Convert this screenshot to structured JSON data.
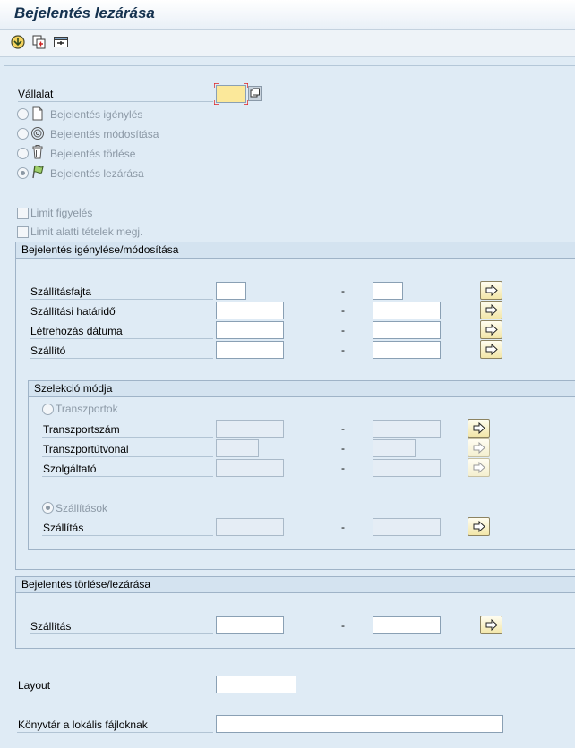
{
  "window": {
    "title": "Bejelentés lezárása"
  },
  "toolbar": {
    "buttons": [
      {
        "icon": "execute-icon"
      },
      {
        "icon": "copy-variant-icon"
      },
      {
        "icon": "selection-options-icon"
      }
    ]
  },
  "header": {
    "company_label": "Vállalat",
    "company_value": ""
  },
  "mode_options": [
    {
      "label": "Bejelentés igénylés",
      "icon": "document-icon",
      "selected": false
    },
    {
      "label": "Bejelentés módosítása",
      "icon": "spiral-icon",
      "selected": false
    },
    {
      "label": "Bejelentés törlése",
      "icon": "trash-icon",
      "selected": false
    },
    {
      "label": "Bejelentés lezárása",
      "icon": "flag-icon",
      "selected": true
    }
  ],
  "checkboxes": {
    "limit_watch": "Limit figyelés",
    "below_limit_items": "Limit alatti tételek megj."
  },
  "request_group": {
    "title": "Bejelentés igénylése/módosítása",
    "rows": [
      {
        "label": "Szállításfajta",
        "from": "",
        "to": ""
      },
      {
        "label": "Szállítási határidő",
        "from": "",
        "to": ""
      },
      {
        "label": "Létrehozás dátuma",
        "from": "",
        "to": ""
      },
      {
        "label": "Szállító",
        "from": "",
        "to": ""
      }
    ],
    "selection": {
      "title": "Szelekció módja",
      "transports_radio": "Transzportok",
      "transport_rows": [
        {
          "label": "Transzportszám",
          "from": "",
          "to": ""
        },
        {
          "label": "Transzportútvonal",
          "from": "",
          "to": ""
        },
        {
          "label": "Szolgáltató",
          "from": "",
          "to": ""
        }
      ],
      "deliveries_radio": "Szállítások",
      "delivery_row": {
        "label": "Szállítás",
        "from": "",
        "to": ""
      }
    }
  },
  "close_group": {
    "title": "Bejelentés törlése/lezárása",
    "row": {
      "label": "Szállítás",
      "from": "",
      "to": ""
    }
  },
  "layout_label": "Layout",
  "layout_value": "",
  "local_dir_label": "Könyvtár a lokális fájloknak",
  "local_dir_value": "",
  "range_separator": "-"
}
